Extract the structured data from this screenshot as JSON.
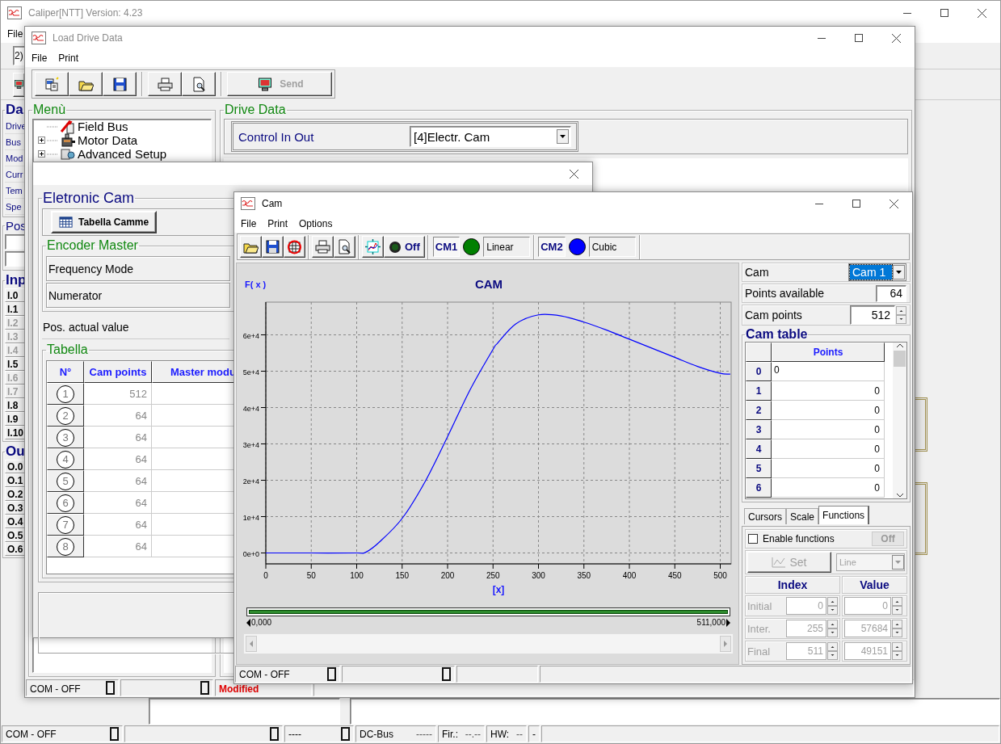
{
  "main_window": {
    "title": "Caliper[NTT] Version: 4.23",
    "menu": [
      "File"
    ],
    "toolbar_field": "2)",
    "sidebar": {
      "title": "Da",
      "items": [
        "Drive",
        "Bus",
        "Mod",
        "Curr",
        "Tem",
        "Spe"
      ],
      "position_title": "Pos",
      "inputs_title": "Inp",
      "inputs": [
        {
          "label": "I.0",
          "active": true
        },
        {
          "label": "I.1",
          "active": true
        },
        {
          "label": "I.2",
          "active": false
        },
        {
          "label": "I.3",
          "active": false
        },
        {
          "label": "I.4",
          "active": false
        },
        {
          "label": "I.5",
          "active": true
        },
        {
          "label": "I.6",
          "active": false
        },
        {
          "label": "I.7",
          "active": false
        },
        {
          "label": "I.8",
          "active": true
        },
        {
          "label": "I.9",
          "active": true
        },
        {
          "label": "I.10",
          "active": true
        }
      ],
      "outputs_title": "Ou",
      "outputs": [
        "O.0",
        "O.1",
        "O.2",
        "O.3",
        "O.4",
        "O.5",
        "O.6"
      ]
    },
    "status_bar": [
      {
        "text": "COM - OFF",
        "led": true
      },
      {
        "led": true
      },
      {
        "text": "----",
        "led": true
      },
      {
        "text": "DC-Bus",
        "value": "-----",
        "led": false
      },
      {
        "text": "Fir.:",
        "value": "--.--",
        "led": false
      },
      {
        "text": "HW:",
        "value": "--",
        "led": false
      },
      {
        "text": "-",
        "led": false
      },
      {
        "led": false
      }
    ]
  },
  "load_drive_data": {
    "title": "Load Drive Data",
    "menu": [
      "File",
      "Print"
    ],
    "send_button": {
      "label": "Send",
      "disabled": true
    },
    "menu_panel": {
      "title": "Menù",
      "tree": [
        {
          "label": "Field Bus"
        },
        {
          "label": "Motor Data",
          "expanded": false
        },
        {
          "label": "Advanced Setup",
          "expanded": false
        }
      ]
    },
    "drive_data": {
      "title": "Drive Data",
      "field_label": "Control In Out",
      "field_value": "[4]Electr. Cam"
    },
    "status_bar": [
      {
        "text": "COM - OFF",
        "led": true
      },
      {
        "led": true
      },
      {
        "text": "Modified",
        "led": false,
        "color": "#e00000"
      },
      {
        "led": false
      }
    ]
  },
  "eletronic_cam": {
    "title": "Eletronic Cam",
    "button": "Tabella Camme",
    "encoder_title": "Encoder Master",
    "encoder_fields": [
      "Frequency Mode",
      "Numerator"
    ],
    "position_label": "Pos. actual value",
    "table_title": "Tabella",
    "table": {
      "columns": [
        "N°",
        "Cam points",
        "Master modu"
      ],
      "rows": [
        {
          "n": "1",
          "cam_points": "512"
        },
        {
          "n": "2",
          "cam_points": "64"
        },
        {
          "n": "3",
          "cam_points": "64"
        },
        {
          "n": "4",
          "cam_points": "64"
        },
        {
          "n": "5",
          "cam_points": "64"
        },
        {
          "n": "6",
          "cam_points": "64"
        },
        {
          "n": "7",
          "cam_points": "64"
        },
        {
          "n": "8",
          "cam_points": "64"
        }
      ]
    }
  },
  "cam_window": {
    "title": "Cam",
    "menu": [
      "File",
      "Print",
      "Options"
    ],
    "led_button": {
      "label": "Off",
      "on": false
    },
    "curves": [
      {
        "label": "CM1",
        "color": "#008000",
        "mode": "Linear"
      },
      {
        "label": "CM2",
        "color": "#0000ff",
        "mode": "Cubic"
      }
    ],
    "chart": {
      "chart_data": {
        "type": "line",
        "title": "CAM",
        "xlabel": "[x]",
        "ylabel": "F( x )",
        "xlim": [
          0,
          512
        ],
        "ylim": [
          -3000,
          69000
        ],
        "grid": true,
        "xticks": [
          0,
          50,
          100,
          150,
          200,
          250,
          300,
          350,
          400,
          450,
          500
        ],
        "yticks": [
          {
            "value": 0,
            "label": "0e+0"
          },
          {
            "value": 10000,
            "label": "1e+4"
          },
          {
            "value": 20000,
            "label": "2e+4"
          },
          {
            "value": 30000,
            "label": "3e+4"
          },
          {
            "value": 40000,
            "label": "4e+4"
          },
          {
            "value": 50000,
            "label": "5e+4"
          },
          {
            "value": 60000,
            "label": "6e+4"
          }
        ],
        "x": [
          0,
          50,
          100,
          110,
          125,
          150,
          175,
          200,
          225,
          250,
          255,
          275,
          300,
          325,
          350,
          375,
          400,
          425,
          450,
          475,
          500,
          511
        ],
        "series": [
          {
            "color": "#0000ff",
            "values": [
              0,
              0,
              0,
              200,
              3000,
              9500,
              19500,
              32000,
              45000,
              56000,
              57700,
              63000,
              65500,
              65200,
              63500,
              61300,
              58800,
              56300,
              53800,
              51300,
              49400,
              49200
            ]
          }
        ]
      }
    },
    "range": {
      "start": "0,000",
      "end": "511,000",
      "level": 1
    },
    "cam_select": {
      "label": "Cam",
      "value": "Cam 1"
    },
    "points_available": {
      "label": "Points available",
      "value": "64"
    },
    "cam_points": {
      "label": "Cam points",
      "value": "512"
    },
    "cam_table": {
      "title": "Cam table",
      "column": "Points",
      "rows": [
        {
          "index": "0",
          "value": "0",
          "editing": true
        },
        {
          "index": "1",
          "value": "0",
          "editing": false
        },
        {
          "index": "2",
          "value": "0",
          "editing": false
        },
        {
          "index": "3",
          "value": "0",
          "editing": false
        },
        {
          "index": "4",
          "value": "0",
          "editing": false
        },
        {
          "index": "5",
          "value": "0",
          "editing": false
        },
        {
          "index": "6",
          "value": "0",
          "editing": false
        }
      ]
    },
    "tabs": [
      {
        "label": "Cursors",
        "selected": false
      },
      {
        "label": "Scale",
        "selected": false
      },
      {
        "label": "Functions",
        "selected": true
      }
    ],
    "functions": {
      "enable_label": "Enable functions",
      "checked": false,
      "state_button": "Off",
      "set_button": "Set",
      "shape": "Line",
      "disabled": true,
      "columns": [
        "Index",
        "Value"
      ],
      "rows": [
        {
          "label": "Initial",
          "index": "0",
          "value": "0"
        },
        {
          "label": "Inter.",
          "index": "255",
          "value": "57684"
        },
        {
          "label": "Final",
          "index": "511",
          "value": "49151"
        }
      ]
    },
    "status_bar": [
      {
        "text": "COM - OFF",
        "led": true
      },
      {
        "led": true
      },
      {
        "led": false
      },
      {
        "led": false
      }
    ]
  }
}
